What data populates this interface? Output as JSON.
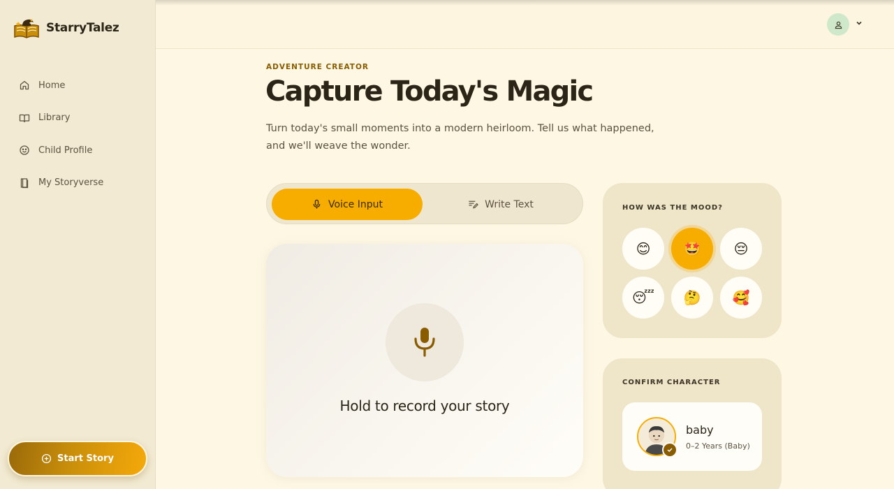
{
  "app": {
    "name": "StarryTalez"
  },
  "sidebar": {
    "items": [
      {
        "label": "Home",
        "icon": "home-icon"
      },
      {
        "label": "Library",
        "icon": "book-open-icon"
      },
      {
        "label": "Child Profile",
        "icon": "smiley-icon"
      },
      {
        "label": "My Storyverse",
        "icon": "book-icon"
      }
    ],
    "cta_label": "Start Story"
  },
  "header": {
    "eyebrow": "ADVENTURE CREATOR",
    "title": "Capture Today's Magic",
    "subtitle": "Turn today's small moments into a modern heirloom. Tell us what happened, and we'll weave the wonder."
  },
  "input_mode": {
    "voice_label": "Voice Input",
    "text_label": "Write Text",
    "selected": "Voice Input"
  },
  "recorder": {
    "prompt": "Hold to record your story"
  },
  "mood": {
    "label": "HOW WAS THE MOOD?",
    "options": [
      "😊",
      "🤩",
      "😔",
      "😴",
      "🤔",
      "🥰"
    ],
    "selected_index": 1
  },
  "character": {
    "label": "CONFIRM CHARACTER",
    "name": "baby",
    "age": "0–2 Years (Baby)"
  },
  "colors": {
    "accent": "#f7ac00",
    "brand_dark": "#8a5c00",
    "background": "#fdf7e4",
    "sidebar": "#f2ead2"
  }
}
